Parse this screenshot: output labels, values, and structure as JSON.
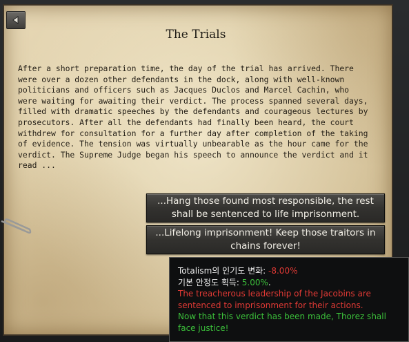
{
  "event": {
    "title": "The Trials",
    "description": "After a short preparation time, the day of the trial has arrived. There were over a dozen other defendants in the dock, along with well-known politicians and officers such as Jacques Duclos and Marcel Cachin, who were waiting for awaiting their verdict. The process spanned several days, filled with dramatic speeches by the defendants and courageous lectures by prosecutors. After all the defendants had finally been heard, the court withdrew for consultation for a further day after completion of the taking of evidence. The tension was virtually unbearable as the hour came for the verdict. The Supreme Judge began his speech to announce the verdict and it read ...",
    "options": [
      "...Hang those found most responsible, the rest shall be sentenced to life imprisonment.",
      "...Lifelong imprisonment! Keep those traitors in chains forever!"
    ]
  },
  "tooltip": {
    "line1_label": "Totalism의 인기도 변화: ",
    "line1_value": "-8.00%",
    "line2_label": "기본 안정도 획득: ",
    "line2_value": "5.00%",
    "line2_suffix": ".",
    "effect_red": "The treacherous leadership of the Jacobins are sentenced to imprisonment for their actions.",
    "effect_green": "Now that this verdict has been made, Thorez shall face justice!"
  },
  "colors": {
    "negative": "#e23a35",
    "positive": "#3bbf3a"
  }
}
